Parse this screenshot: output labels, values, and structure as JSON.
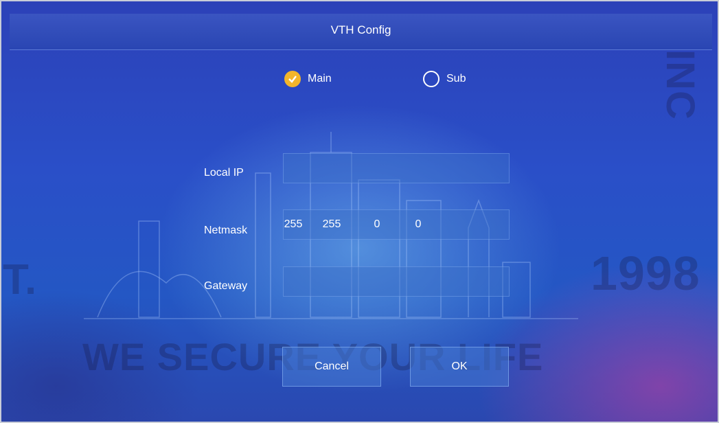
{
  "window": {
    "title": "VTH Config"
  },
  "mode": {
    "options": [
      {
        "label": "Main",
        "selected": true
      },
      {
        "label": "Sub",
        "selected": false
      }
    ]
  },
  "fields": {
    "local_ip": {
      "label": "Local IP",
      "value": ""
    },
    "netmask": {
      "label": "Netmask",
      "octets": [
        "255",
        "255",
        "0",
        "0"
      ]
    },
    "gateway": {
      "label": "Gateway",
      "value": ""
    }
  },
  "buttons": {
    "cancel": "Cancel",
    "ok": "OK"
  },
  "watermark": {
    "slogan": "WE SECURE YOUR LIFE",
    "year": "1998",
    "est": "T.",
    "corner_letters": "INC"
  },
  "colors": {
    "accent": "#f3b52a",
    "background": "#2a4fc8"
  }
}
